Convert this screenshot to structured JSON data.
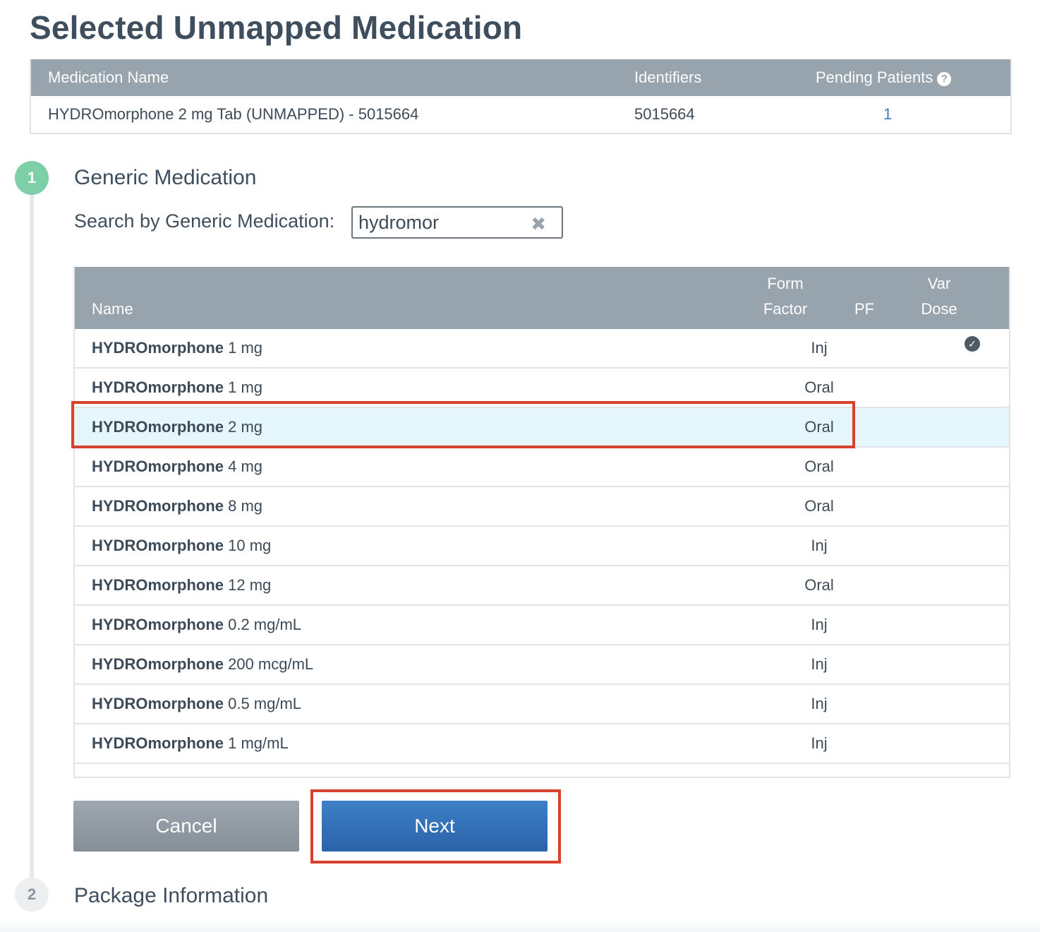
{
  "page": {
    "title": "Selected Unmapped Medication"
  },
  "selected_table": {
    "headers": {
      "name": "Medication Name",
      "identifiers": "Identifiers",
      "pending": "Pending Patients"
    },
    "row": {
      "name": "HYDROmorphone 2 mg Tab (UNMAPPED) - 5015664",
      "identifiers": "5015664",
      "pending": "1"
    }
  },
  "step1": {
    "number": "1",
    "title": "Generic Medication",
    "search_label": "Search by Generic Medication:",
    "search_value": "hydromor"
  },
  "results": {
    "headers": {
      "name": "Name",
      "form_factor_line1": "Form",
      "form_factor_line2": "Factor",
      "pf": "PF",
      "var_dose_line1": "Var",
      "var_dose_line2": "Dose"
    },
    "rows": [
      {
        "drug": "HYDROmorphone",
        "strength": " 1 mg",
        "form": "Inj",
        "var_dose": true
      },
      {
        "drug": "HYDROmorphone",
        "strength": " 1 mg",
        "form": "Oral",
        "var_dose": false
      },
      {
        "drug": "HYDROmorphone",
        "strength": " 2 mg",
        "form": "Oral",
        "var_dose": false,
        "selected": true
      },
      {
        "drug": "HYDROmorphone",
        "strength": " 4 mg",
        "form": "Oral",
        "var_dose": false
      },
      {
        "drug": "HYDROmorphone",
        "strength": " 8 mg",
        "form": "Oral",
        "var_dose": false
      },
      {
        "drug": "HYDROmorphone",
        "strength": " 10 mg",
        "form": "Inj",
        "var_dose": false
      },
      {
        "drug": "HYDROmorphone",
        "strength": " 12 mg",
        "form": "Oral",
        "var_dose": false
      },
      {
        "drug": "HYDROmorphone",
        "strength": " 0.2 mg/mL",
        "form": "Inj",
        "var_dose": false
      },
      {
        "drug": "HYDROmorphone",
        "strength": " 200 mcg/mL",
        "form": "Inj",
        "var_dose": false
      },
      {
        "drug": "HYDROmorphone",
        "strength": " 0.5 mg/mL",
        "form": "Inj",
        "var_dose": false
      },
      {
        "drug": "HYDROmorphone",
        "strength": " 1 mg/mL",
        "form": "Inj",
        "var_dose": false
      }
    ]
  },
  "buttons": {
    "cancel": "Cancel",
    "next": "Next"
  },
  "step2": {
    "number": "2",
    "title": "Package Information"
  },
  "colors": {
    "header_bg": "#97a3ad",
    "selected_row": "#e6f6fd",
    "highlight": "#d9412f",
    "next_button": "#2f6cb4",
    "step_active": "#7ccfa6"
  }
}
